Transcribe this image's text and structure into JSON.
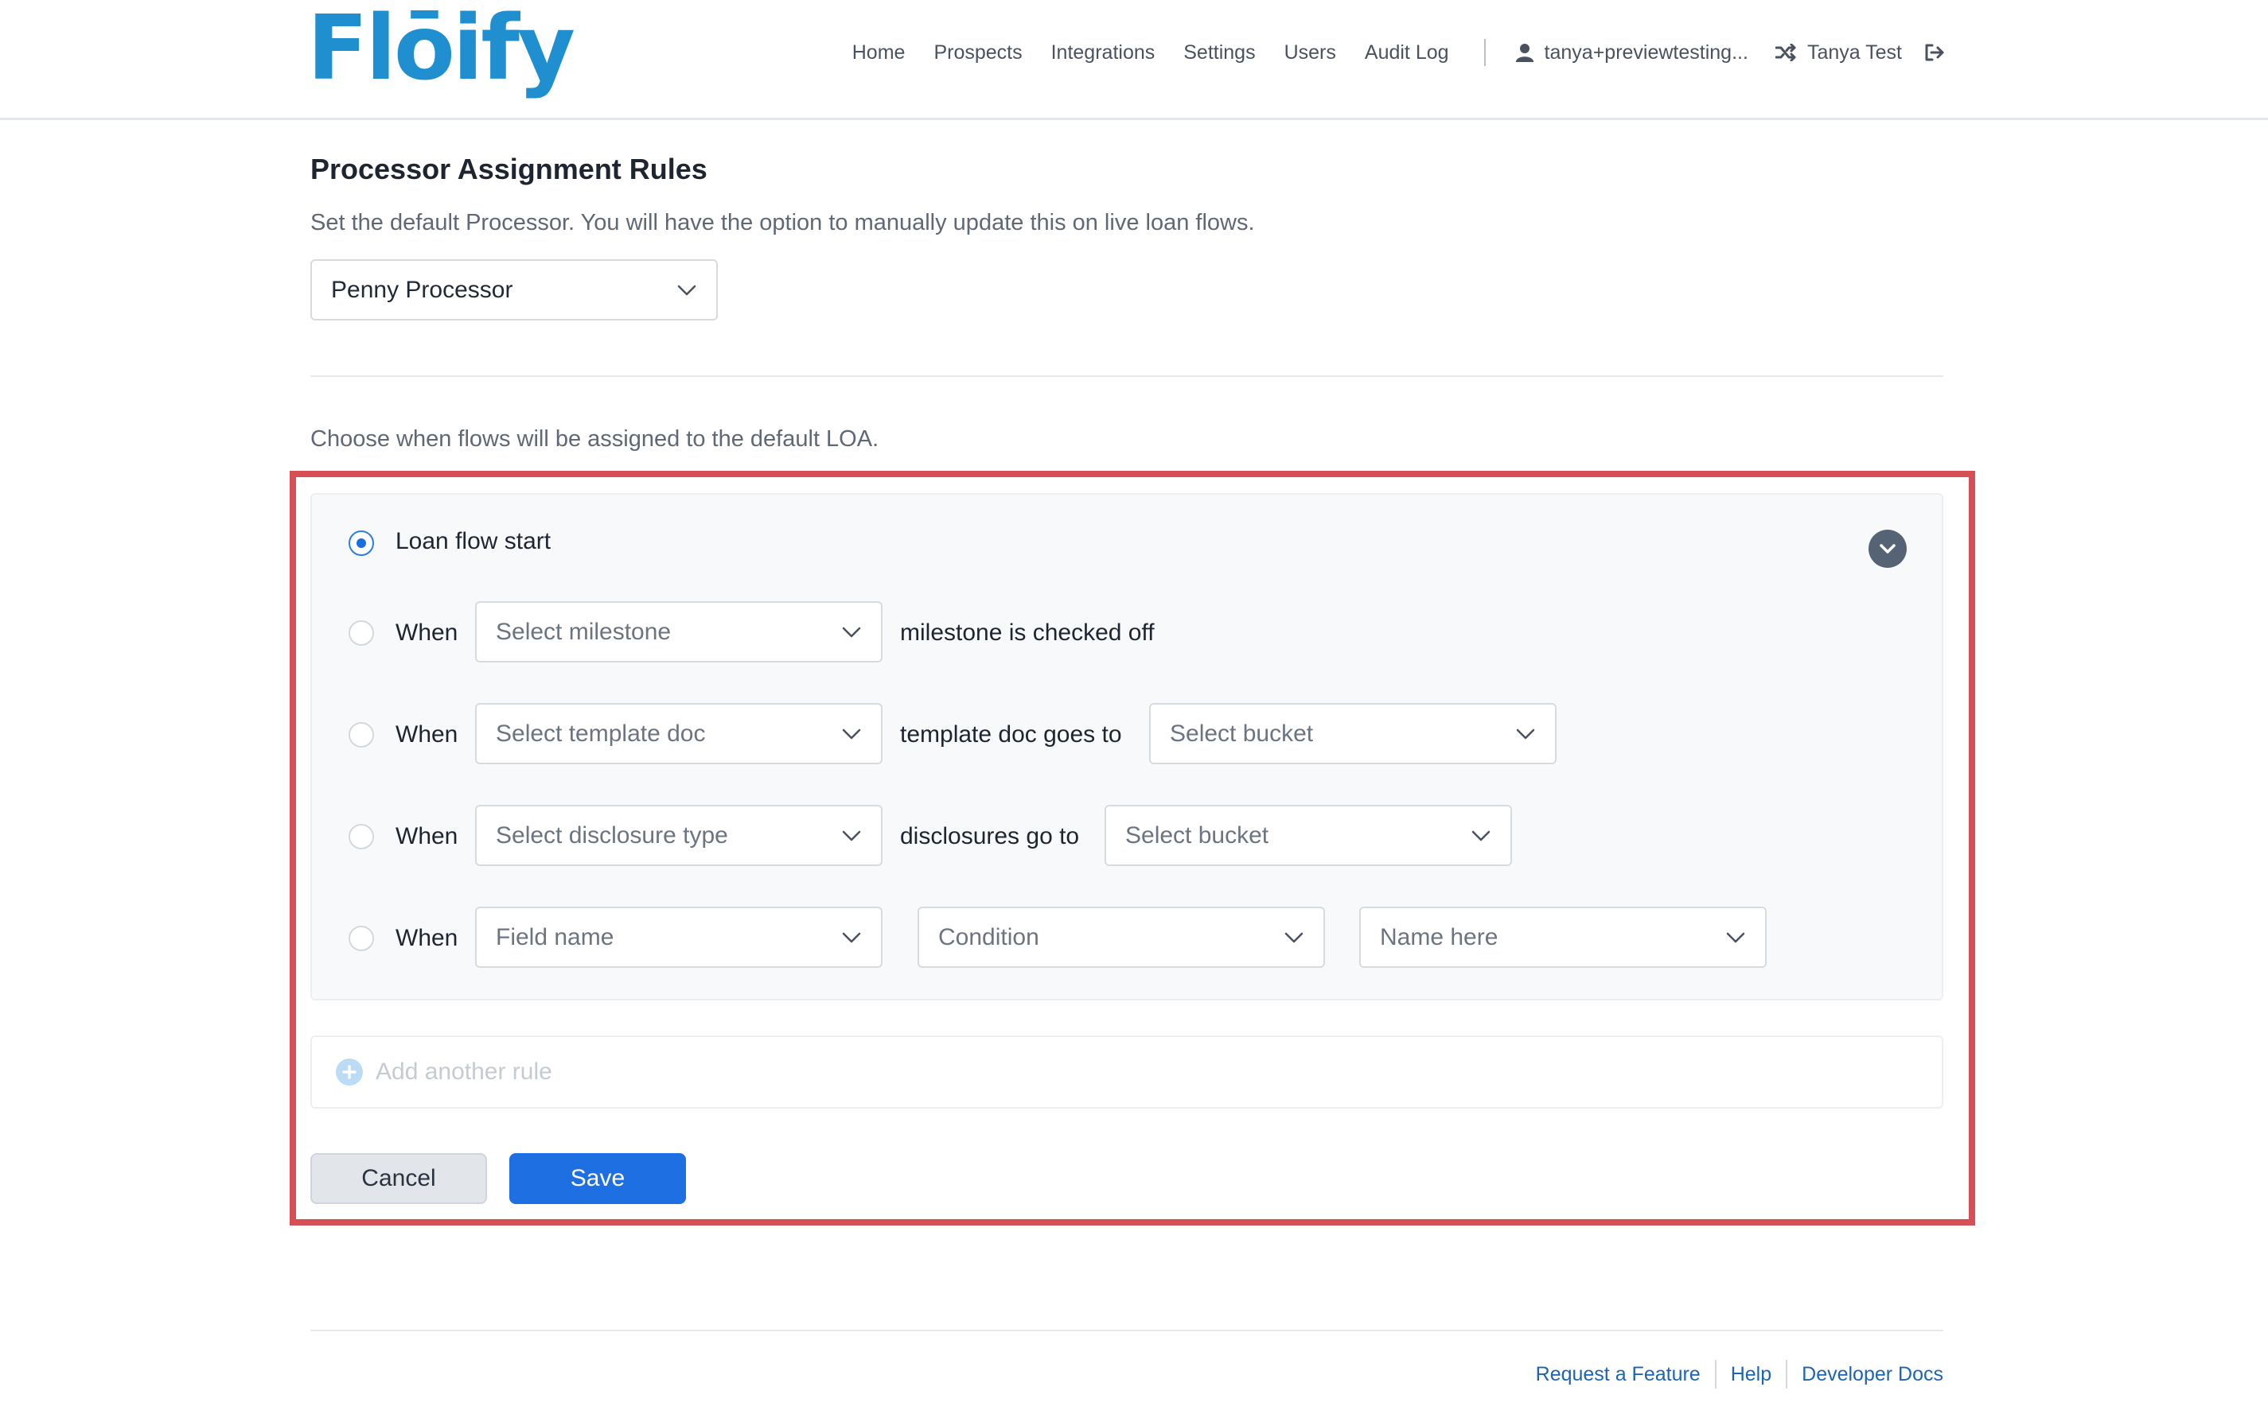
{
  "header": {
    "logo": "Flōify",
    "nav": [
      "Home",
      "Prospects",
      "Integrations",
      "Settings",
      "Users",
      "Audit Log"
    ],
    "user_email": "tanya+previewtesting...",
    "switch_user": "Tanya Test"
  },
  "main": {
    "title": "Processor Assignment Rules",
    "subtitle": "Set the default Processor. You will have the option to manually update this on live loan flows.",
    "default_processor": "Penny Processor",
    "choose_text": "Choose when flows will be assigned to the default LOA.",
    "rules": {
      "loan_flow_start": "Loan flow start",
      "when": "When",
      "milestone": {
        "placeholder": "Select milestone",
        "suffix": "milestone is checked off"
      },
      "template": {
        "placeholder": "Select template doc",
        "middle": "template doc goes to",
        "bucket": "Select bucket"
      },
      "disclosure": {
        "placeholder": "Select disclosure type",
        "middle": "disclosures go to",
        "bucket": "Select bucket"
      },
      "field": {
        "field_name": "Field name",
        "condition": "Condition",
        "name_here": "Name here"
      }
    },
    "add_rule": "Add another rule",
    "cancel": "Cancel",
    "save": "Save"
  },
  "footer": {
    "links": [
      "Request a Feature",
      "Help",
      "Developer Docs"
    ]
  },
  "colors": {
    "brand": "#1f8fd0",
    "primary_button": "#1d6fe2",
    "highlight_border": "#d64f55",
    "link": "#1d65b4"
  },
  "icons": [
    "user-icon",
    "shuffle-icon",
    "logout-icon",
    "chevron-down-icon",
    "collapse-chevron-icon",
    "plus-circle-icon"
  ]
}
